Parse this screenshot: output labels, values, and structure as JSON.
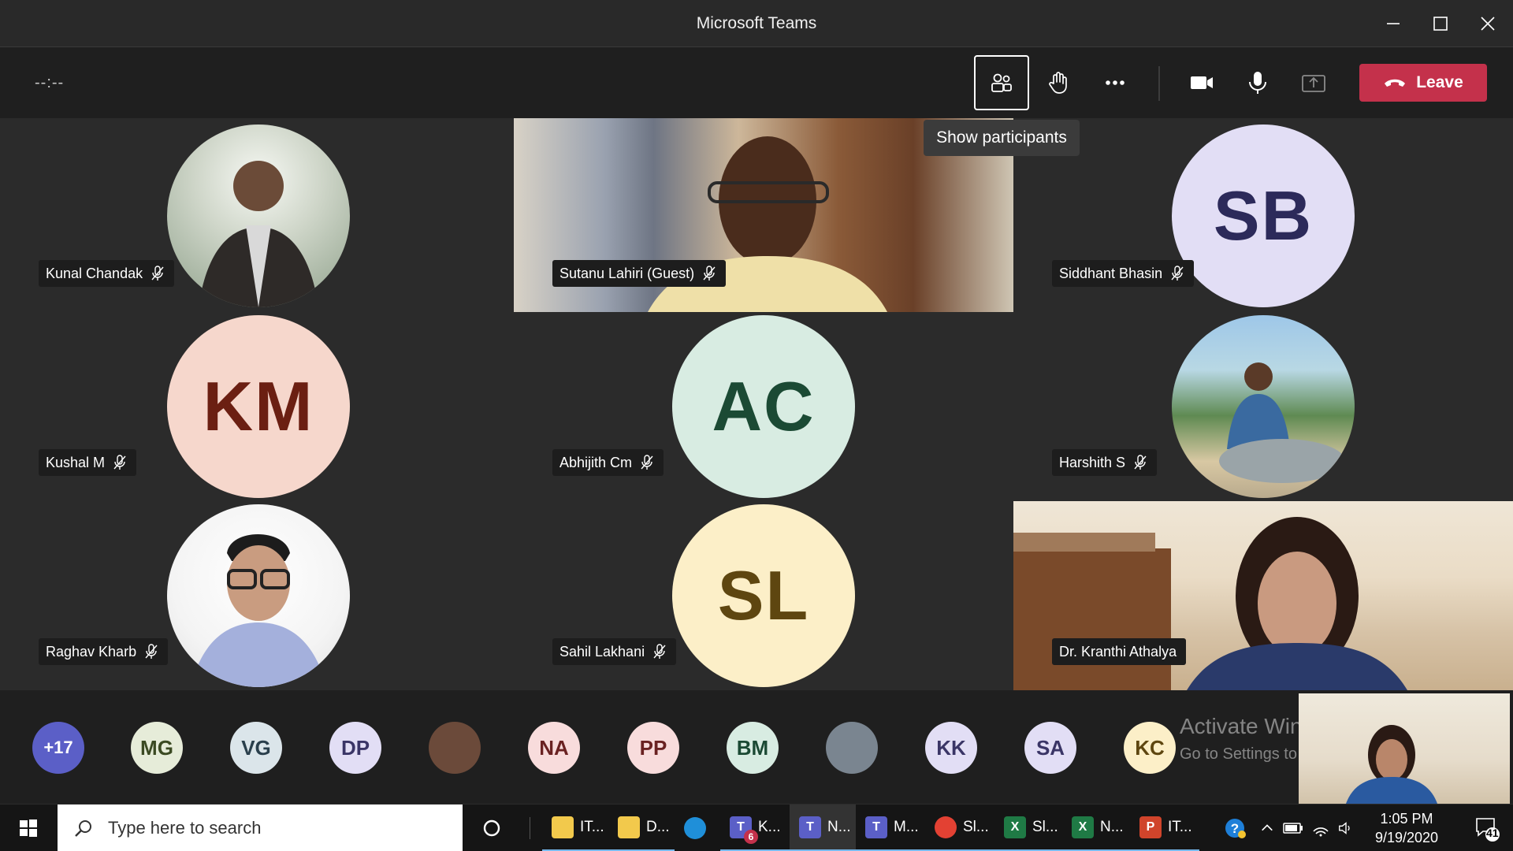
{
  "window": {
    "title": "Microsoft Teams"
  },
  "toolbar": {
    "timer": "--:--",
    "leave_label": "Leave",
    "tooltip": "Show participants"
  },
  "tiles": [
    {
      "name": "Kunal Chandak",
      "kind": "photo"
    },
    {
      "name": "Sutanu Lahiri (Guest)",
      "kind": "video"
    },
    {
      "name": "Siddhant Bhasin",
      "initials": "SB",
      "bg": "#e2def5",
      "fg": "#2c2a5a"
    },
    {
      "name": "Kushal M",
      "initials": "KM",
      "bg": "#f6d7cc",
      "fg": "#6b1f12"
    },
    {
      "name": "Abhijith Cm",
      "initials": "AC",
      "bg": "#d8ece2",
      "fg": "#1b4a34"
    },
    {
      "name": "Harshith S",
      "kind": "photo"
    },
    {
      "name": "Raghav Kharb",
      "kind": "photo"
    },
    {
      "name": "Sahil Lakhani",
      "initials": "SL",
      "bg": "#fcefc8",
      "fg": "#5e4610"
    },
    {
      "name": "Dr. Kranthi Athalya",
      "kind": "video"
    }
  ],
  "strip": {
    "overflow": "+17",
    "participants": [
      {
        "initials": "MG",
        "bg": "#e6ecd9",
        "fg": "#3b4a22"
      },
      {
        "initials": "VG",
        "bg": "#dbe5ea",
        "fg": "#2a3f4c"
      },
      {
        "initials": "DP",
        "bg": "#e2def5",
        "fg": "#3a3566"
      },
      {
        "initials": "",
        "bg": "#6b4a3a",
        "fg": "#ffffff"
      },
      {
        "initials": "NA",
        "bg": "#f8dcdc",
        "fg": "#6a2222"
      },
      {
        "initials": "PP",
        "bg": "#f8dcdc",
        "fg": "#6a2222"
      },
      {
        "initials": "BM",
        "bg": "#d8ece2",
        "fg": "#1b4a34"
      },
      {
        "initials": "",
        "bg": "#7a8590",
        "fg": "#ffffff"
      },
      {
        "initials": "KK",
        "bg": "#e2def5",
        "fg": "#3a3566"
      },
      {
        "initials": "SA",
        "bg": "#e2def5",
        "fg": "#3a3566"
      },
      {
        "initials": "KC",
        "bg": "#fcefc8",
        "fg": "#5e4610"
      }
    ],
    "watermark_title": "Activate Windows",
    "watermark_sub": "Go to Settings to activate Windows."
  },
  "taskbar": {
    "search_placeholder": "Type here to search",
    "apps": [
      {
        "label": "IT...",
        "icon": "folder-icon"
      },
      {
        "label": "D...",
        "icon": "downloads-folder-icon"
      },
      {
        "label": "",
        "icon": "edge-icon"
      },
      {
        "label": "K...",
        "icon": "teams-icon",
        "badge": "6"
      },
      {
        "label": "N...",
        "icon": "teams-icon"
      },
      {
        "label": "M...",
        "icon": "teams-icon"
      },
      {
        "label": "Sl...",
        "icon": "chrome-icon"
      },
      {
        "label": "Sl...",
        "icon": "excel-icon"
      },
      {
        "label": "N...",
        "icon": "excel-icon"
      },
      {
        "label": "IT...",
        "icon": "powerpoint-icon"
      }
    ],
    "time": "1:05 PM",
    "date": "9/19/2020",
    "notifications": "41"
  }
}
